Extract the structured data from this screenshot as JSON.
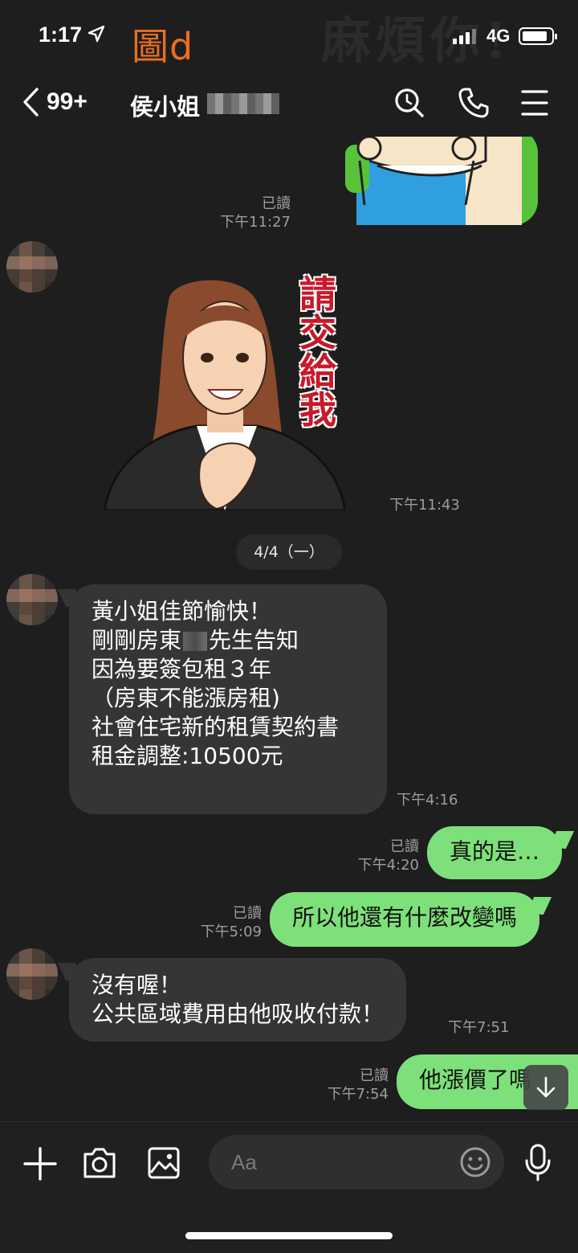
{
  "status_bar": {
    "time": "1:17",
    "network": "4G",
    "watermark_logo": "圖d",
    "watermark_text": "麻煩你!"
  },
  "header": {
    "back_count": "99+",
    "title": "侯小姐"
  },
  "date_separator": "4/4（一）",
  "stickers": {
    "sticker2_text": [
      "請",
      "交",
      "給",
      "我"
    ]
  },
  "messages": [
    {
      "dir": "out",
      "type": "sticker",
      "read": "已讀",
      "time": "下午11:27"
    },
    {
      "dir": "in",
      "type": "sticker",
      "time": "下午11:43"
    },
    {
      "dir": "in",
      "type": "text",
      "lines": [
        "黃小姐佳節愉快！",
        "剛剛房東",
        "先生告知",
        "因為要簽包租３年",
        "（房東不能漲房租)",
        "社會住宅新的租賃契約書",
        "租金調整:10500元"
      ],
      "time": "下午4:16"
    },
    {
      "dir": "out",
      "type": "text",
      "text": "真的是…",
      "read": "已讀",
      "time": "下午4:20"
    },
    {
      "dir": "out",
      "type": "text",
      "text": "所以他還有什麼改變嗎",
      "read": "已讀",
      "time": "下午5:09"
    },
    {
      "dir": "in",
      "type": "text",
      "lines": [
        "沒有喔！",
        "公共區域費用由他吸收付款！"
      ],
      "time": "下午7:51"
    },
    {
      "dir": "out",
      "type": "text",
      "text": "他漲價了嗎",
      "read": "已讀",
      "time": "下午7:54"
    }
  ],
  "input": {
    "placeholder": "Aa"
  },
  "icons": {
    "header": [
      "search-icon",
      "phone-icon",
      "menu-icon"
    ],
    "input_bar": [
      "plus-icon",
      "camera-icon",
      "image-icon",
      "emoji-icon",
      "microphone-icon"
    ],
    "scroll": "arrow-down-icon"
  },
  "colors": {
    "background": "#1e1e1e",
    "incoming_bubble": "#353535",
    "outgoing_bubble": "#7ee07a",
    "meta_text": "#9d9d9d",
    "watermark": "#e86f22",
    "sticker_red": "#c9182a"
  }
}
